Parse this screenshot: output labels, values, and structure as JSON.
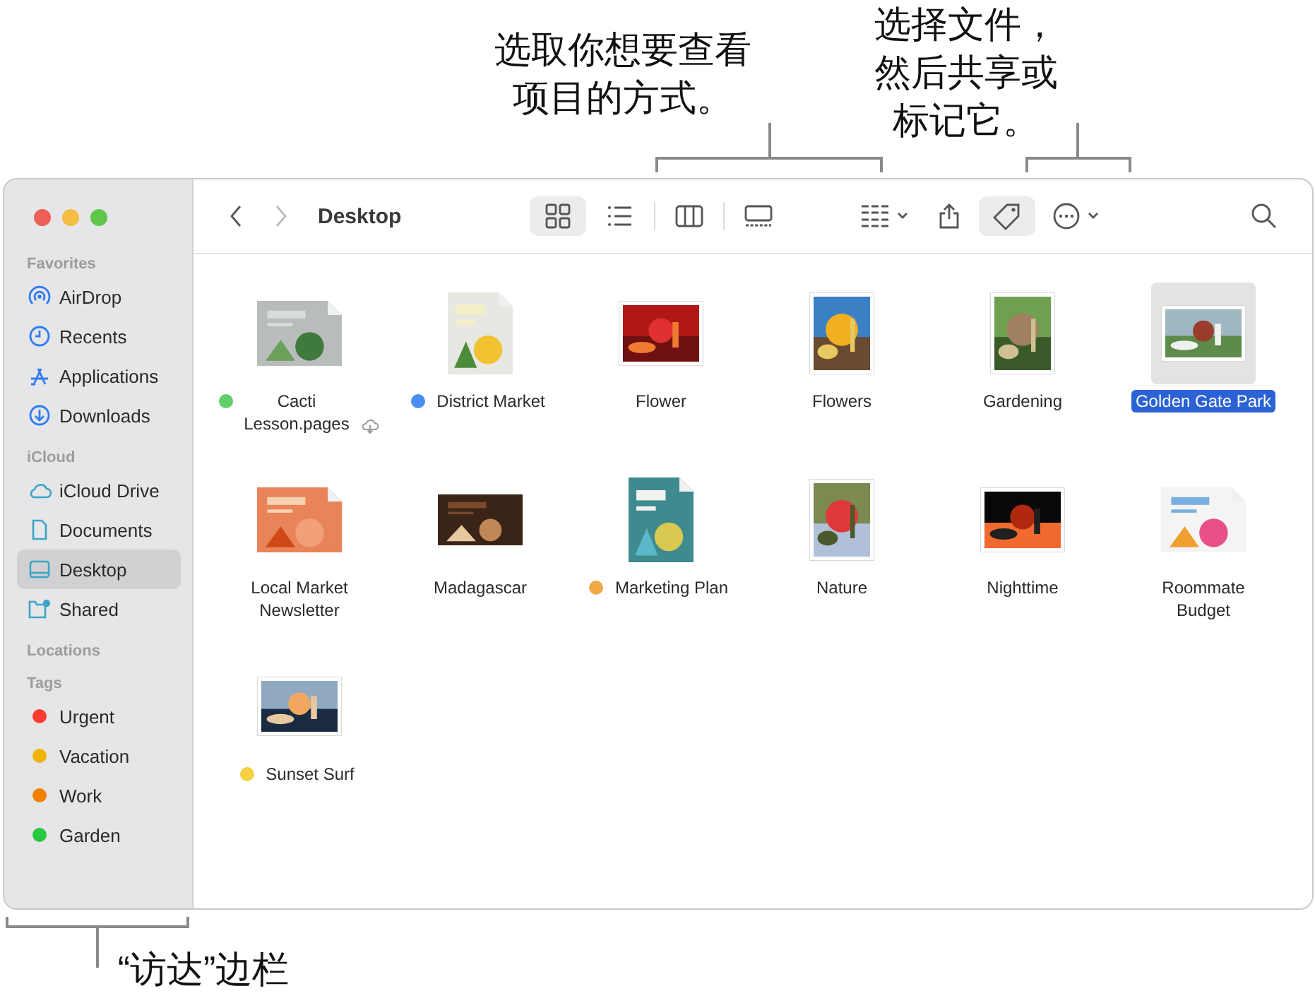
{
  "callouts": [
    {
      "lines": [
        "选取你想要查看",
        "项目的方式。"
      ]
    },
    {
      "lines": [
        "选择文件，",
        "然后共享或",
        "标记它。"
      ]
    },
    {
      "lines": [
        "“访达”边栏"
      ]
    }
  ],
  "sidebar": {
    "sections": [
      {
        "heading": "Favorites",
        "items": [
          {
            "label": "AirDrop",
            "selected": false
          },
          {
            "label": "Recents",
            "selected": false
          },
          {
            "label": "Applications",
            "selected": false
          },
          {
            "label": "Downloads",
            "selected": false
          }
        ]
      },
      {
        "heading": "iCloud",
        "items": [
          {
            "label": "iCloud Drive",
            "selected": false
          },
          {
            "label": "Documents",
            "selected": false
          },
          {
            "label": "Desktop",
            "selected": true
          },
          {
            "label": "Shared",
            "selected": false
          }
        ]
      },
      {
        "heading": "Locations"
      },
      {
        "heading": "Tags",
        "tags": [
          {
            "label": "Urgent",
            "color": "#ff3b30"
          },
          {
            "label": "Vacation",
            "color": "#f0b400"
          },
          {
            "label": "Work",
            "color": "#f08000"
          },
          {
            "label": "Garden",
            "color": "#28c840"
          }
        ]
      }
    ]
  },
  "toolbar": {
    "title": "Desktop",
    "view_modes": [
      {
        "selected": true
      },
      {
        "selected": false
      },
      {
        "selected": false
      },
      {
        "selected": false
      }
    ],
    "tag_active": true
  },
  "files": [
    {
      "name": "Cacti\nLesson.pages",
      "color": "#5fcf66",
      "cloud": true,
      "selected": false,
      "kind": "document"
    },
    {
      "name": "District Market",
      "color": "#4a8ef0",
      "selected": false,
      "kind": "document"
    },
    {
      "name": "Flower",
      "selected": false
    },
    {
      "name": "Flowers",
      "selected": false
    },
    {
      "name": "Gardening",
      "selected": false
    },
    {
      "name": "Golden Gate Park",
      "selected": true
    },
    {
      "name": "Local Market\nNewsletter",
      "selected": false,
      "kind": "document"
    },
    {
      "name": "Madagascar",
      "selected": false,
      "kind": "document"
    },
    {
      "name": "Marketing Plan",
      "color": "#f0a848",
      "selected": false,
      "kind": "document"
    },
    {
      "name": "Nature",
      "selected": false
    },
    {
      "name": "Nighttime",
      "selected": false
    },
    {
      "name": "Roommate\nBudget",
      "selected": false,
      "kind": "document"
    },
    {
      "name": "Sunset Surf",
      "color": "#f5d040",
      "selected": false
    }
  ]
}
